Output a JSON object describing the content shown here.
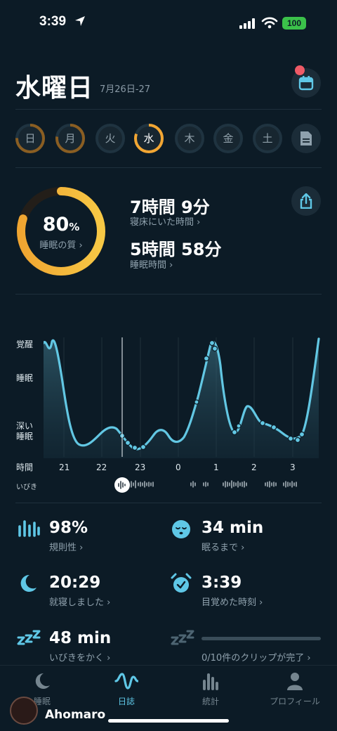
{
  "status_bar": {
    "time": "3:39",
    "battery": "100"
  },
  "header": {
    "title": "水曜日",
    "date_range": "7月26日-27"
  },
  "week_days": [
    {
      "label": "日"
    },
    {
      "label": "月"
    },
    {
      "label": "火"
    },
    {
      "label": "水"
    },
    {
      "label": "木"
    },
    {
      "label": "金"
    },
    {
      "label": "土"
    }
  ],
  "summary": {
    "quality_value": "80",
    "quality_unit": "%",
    "quality_label": "睡眠の質",
    "in_bed_value": "7時間 9分",
    "in_bed_label": "寝床にいた時間",
    "asleep_value": "5時間 58分",
    "asleep_label": "睡眠時間"
  },
  "sleep_chart": {
    "y_labels": [
      "覚醒",
      "睡眠",
      "深い",
      "睡眠"
    ],
    "x_axis_title": "時間",
    "x_ticks": [
      "21",
      "22",
      "23",
      "0",
      "1",
      "2",
      "3"
    ],
    "snore_label": "いびき"
  },
  "stats": [
    {
      "value": "98%",
      "label": "規則性"
    },
    {
      "value": "34 min",
      "label": "眠るまで"
    },
    {
      "value": "20:29",
      "label": "就寝しました"
    },
    {
      "value": "3:39",
      "label": "目覚めた時刻"
    },
    {
      "value": "48 min",
      "label": "いびきをかく"
    },
    {
      "value": "",
      "label": "0/10件のクリップが完了"
    }
  ],
  "tabs": [
    {
      "label": "睡眠"
    },
    {
      "label": "日誌"
    },
    {
      "label": "統計"
    },
    {
      "label": "プロフィール"
    }
  ],
  "watermark": {
    "text": "Ahomaro"
  },
  "colors": {
    "background": "#0c1b26",
    "accent": "#5fc7e6",
    "ring_gold": "#f2b632",
    "alert": "#ee5a66"
  }
}
